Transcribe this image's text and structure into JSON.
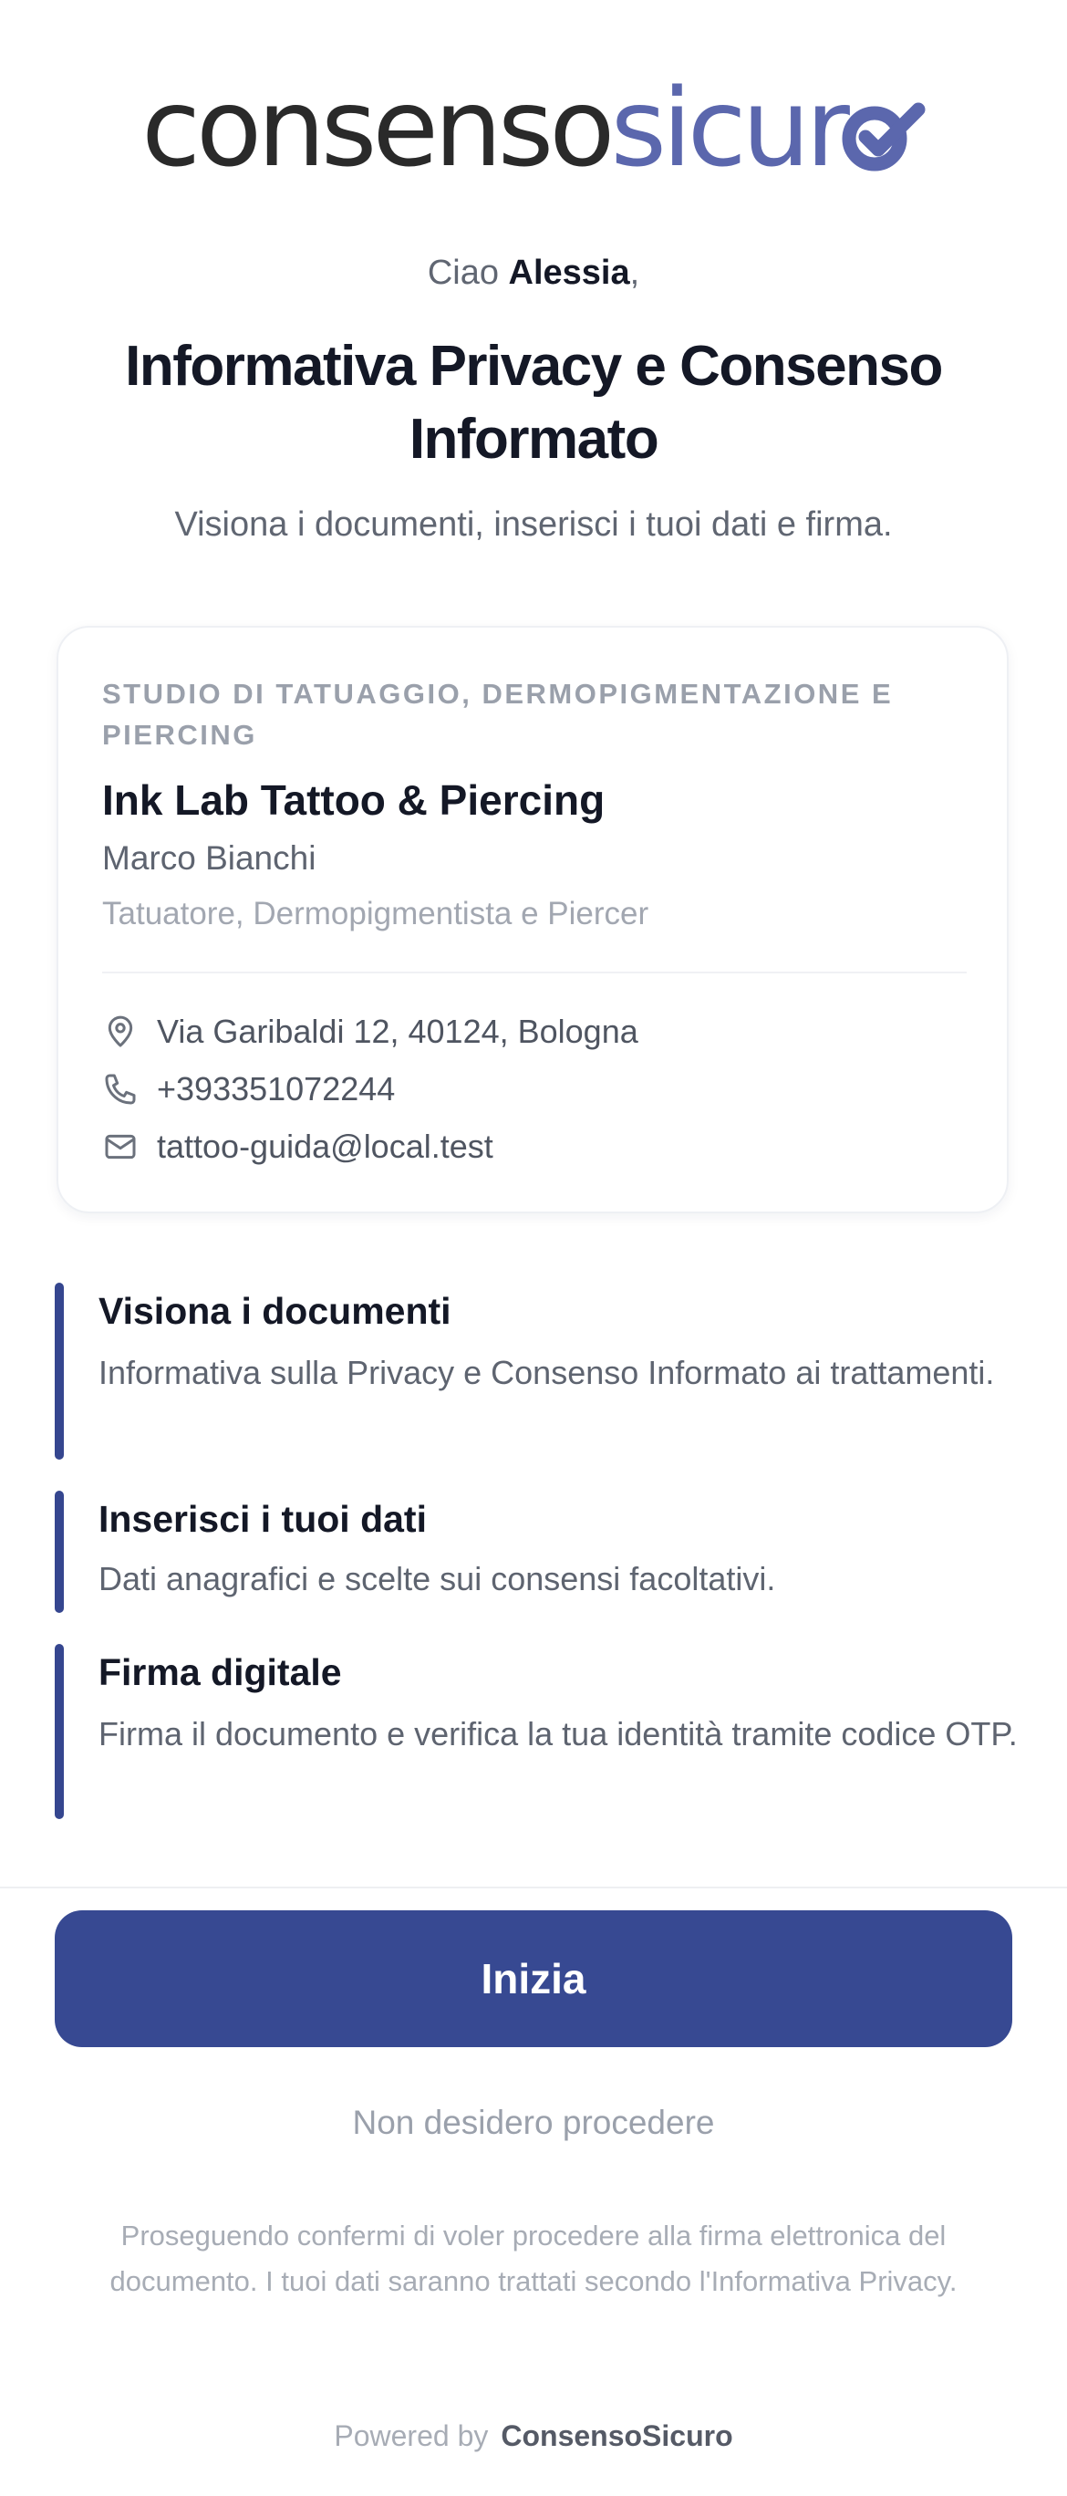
{
  "logo": {
    "part1": "consenso",
    "part2": "sicur"
  },
  "greeting": {
    "prefix": "Ciao ",
    "name": "Alessia",
    "suffix": ","
  },
  "title": "Informativa Privacy e Consenso Informato",
  "subtitle": "Visiona i documenti, inserisci i tuoi dati e firma.",
  "studio": {
    "category": "STUDIO DI TATUAGGIO, DERMOPIGMENTAZIONE E PIERCING",
    "name": "Ink Lab Tattoo & Piercing",
    "person": "Marco Bianchi",
    "role": "Tatuatore, Dermopigmentista e Piercer",
    "address": "Via Garibaldi 12, 40124, Bologna",
    "phone": "+393351072244",
    "email": "tattoo-guida@local.test",
    "icons": [
      "location-pin-icon",
      "phone-icon",
      "mail-icon"
    ]
  },
  "steps": [
    {
      "title": "Visiona i documenti",
      "desc": "Informativa sulla Privacy e Consenso Informato ai trattamenti."
    },
    {
      "title": "Inserisci i tuoi dati",
      "desc": "Dati anagrafici e scelte sui consensi facoltativi."
    },
    {
      "title": "Firma digitale",
      "desc": "Firma il documento e verifica la tua identità tramite codice OTP."
    }
  ],
  "actions": {
    "start_label": "Inizia",
    "decline_label": "Non desidero procedere"
  },
  "legal": "Proseguendo confermi di voler procedere alla firma elettronica del documento. I tuoi dati saranno trattati secondo l'Informativa Privacy.",
  "footer": {
    "powered_by": "Powered by",
    "brand": "ConsensoSicuro"
  },
  "colors": {
    "accent": "#374992",
    "logo_blue": "#5b67ad",
    "step_bar": "#35468f"
  }
}
